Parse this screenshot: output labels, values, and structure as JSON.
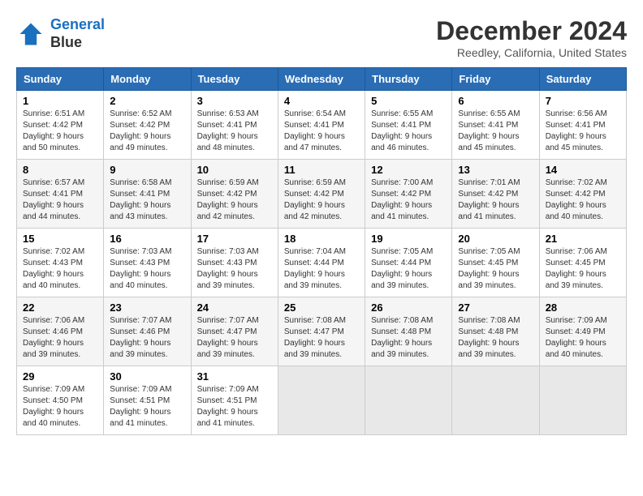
{
  "header": {
    "logo_line1": "General",
    "logo_line2": "Blue",
    "month": "December 2024",
    "location": "Reedley, California, United States"
  },
  "weekdays": [
    "Sunday",
    "Monday",
    "Tuesday",
    "Wednesday",
    "Thursday",
    "Friday",
    "Saturday"
  ],
  "weeks": [
    [
      {
        "day": "1",
        "sunrise": "6:51 AM",
        "sunset": "4:42 PM",
        "daylight": "9 hours and 50 minutes."
      },
      {
        "day": "2",
        "sunrise": "6:52 AM",
        "sunset": "4:42 PM",
        "daylight": "9 hours and 49 minutes."
      },
      {
        "day": "3",
        "sunrise": "6:53 AM",
        "sunset": "4:41 PM",
        "daylight": "9 hours and 48 minutes."
      },
      {
        "day": "4",
        "sunrise": "6:54 AM",
        "sunset": "4:41 PM",
        "daylight": "9 hours and 47 minutes."
      },
      {
        "day": "5",
        "sunrise": "6:55 AM",
        "sunset": "4:41 PM",
        "daylight": "9 hours and 46 minutes."
      },
      {
        "day": "6",
        "sunrise": "6:55 AM",
        "sunset": "4:41 PM",
        "daylight": "9 hours and 45 minutes."
      },
      {
        "day": "7",
        "sunrise": "6:56 AM",
        "sunset": "4:41 PM",
        "daylight": "9 hours and 45 minutes."
      }
    ],
    [
      {
        "day": "8",
        "sunrise": "6:57 AM",
        "sunset": "4:41 PM",
        "daylight": "9 hours and 44 minutes."
      },
      {
        "day": "9",
        "sunrise": "6:58 AM",
        "sunset": "4:41 PM",
        "daylight": "9 hours and 43 minutes."
      },
      {
        "day": "10",
        "sunrise": "6:59 AM",
        "sunset": "4:42 PM",
        "daylight": "9 hours and 42 minutes."
      },
      {
        "day": "11",
        "sunrise": "6:59 AM",
        "sunset": "4:42 PM",
        "daylight": "9 hours and 42 minutes."
      },
      {
        "day": "12",
        "sunrise": "7:00 AM",
        "sunset": "4:42 PM",
        "daylight": "9 hours and 41 minutes."
      },
      {
        "day": "13",
        "sunrise": "7:01 AM",
        "sunset": "4:42 PM",
        "daylight": "9 hours and 41 minutes."
      },
      {
        "day": "14",
        "sunrise": "7:02 AM",
        "sunset": "4:42 PM",
        "daylight": "9 hours and 40 minutes."
      }
    ],
    [
      {
        "day": "15",
        "sunrise": "7:02 AM",
        "sunset": "4:43 PM",
        "daylight": "9 hours and 40 minutes."
      },
      {
        "day": "16",
        "sunrise": "7:03 AM",
        "sunset": "4:43 PM",
        "daylight": "9 hours and 40 minutes."
      },
      {
        "day": "17",
        "sunrise": "7:03 AM",
        "sunset": "4:43 PM",
        "daylight": "9 hours and 39 minutes."
      },
      {
        "day": "18",
        "sunrise": "7:04 AM",
        "sunset": "4:44 PM",
        "daylight": "9 hours and 39 minutes."
      },
      {
        "day": "19",
        "sunrise": "7:05 AM",
        "sunset": "4:44 PM",
        "daylight": "9 hours and 39 minutes."
      },
      {
        "day": "20",
        "sunrise": "7:05 AM",
        "sunset": "4:45 PM",
        "daylight": "9 hours and 39 minutes."
      },
      {
        "day": "21",
        "sunrise": "7:06 AM",
        "sunset": "4:45 PM",
        "daylight": "9 hours and 39 minutes."
      }
    ],
    [
      {
        "day": "22",
        "sunrise": "7:06 AM",
        "sunset": "4:46 PM",
        "daylight": "9 hours and 39 minutes."
      },
      {
        "day": "23",
        "sunrise": "7:07 AM",
        "sunset": "4:46 PM",
        "daylight": "9 hours and 39 minutes."
      },
      {
        "day": "24",
        "sunrise": "7:07 AM",
        "sunset": "4:47 PM",
        "daylight": "9 hours and 39 minutes."
      },
      {
        "day": "25",
        "sunrise": "7:08 AM",
        "sunset": "4:47 PM",
        "daylight": "9 hours and 39 minutes."
      },
      {
        "day": "26",
        "sunrise": "7:08 AM",
        "sunset": "4:48 PM",
        "daylight": "9 hours and 39 minutes."
      },
      {
        "day": "27",
        "sunrise": "7:08 AM",
        "sunset": "4:48 PM",
        "daylight": "9 hours and 39 minutes."
      },
      {
        "day": "28",
        "sunrise": "7:09 AM",
        "sunset": "4:49 PM",
        "daylight": "9 hours and 40 minutes."
      }
    ],
    [
      {
        "day": "29",
        "sunrise": "7:09 AM",
        "sunset": "4:50 PM",
        "daylight": "9 hours and 40 minutes."
      },
      {
        "day": "30",
        "sunrise": "7:09 AM",
        "sunset": "4:51 PM",
        "daylight": "9 hours and 41 minutes."
      },
      {
        "day": "31",
        "sunrise": "7:09 AM",
        "sunset": "4:51 PM",
        "daylight": "9 hours and 41 minutes."
      },
      null,
      null,
      null,
      null
    ]
  ]
}
